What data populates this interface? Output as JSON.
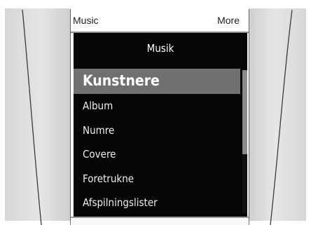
{
  "device": {
    "top_left_label": "Music",
    "top_right_label": "More"
  },
  "screen": {
    "title": "Musik",
    "items": [
      {
        "label": "Kunstnere",
        "selected": true
      },
      {
        "label": "Album"
      },
      {
        "label": "Numre"
      },
      {
        "label": "Covere"
      },
      {
        "label": "Foretrukne"
      },
      {
        "label": "Afspilningslister"
      }
    ]
  },
  "colors": {
    "panel_background": "#050505",
    "selected_background": "#707070",
    "frame_gray": "#d8d8d8"
  }
}
